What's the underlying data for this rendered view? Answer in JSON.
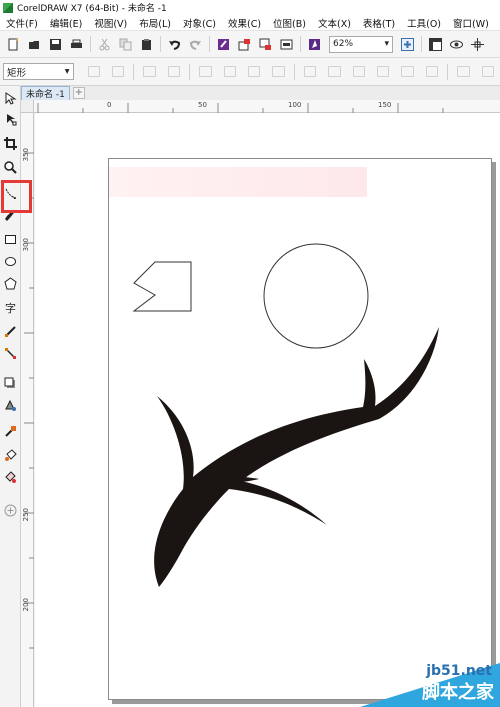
{
  "window": {
    "title": "CorelDRAW X7 (64-Bit) - 未命名 -1"
  },
  "menu": {
    "items": [
      "文件(F)",
      "编辑(E)",
      "视图(V)",
      "布局(L)",
      "对象(C)",
      "效果(C)",
      "位图(B)",
      "文本(X)",
      "表格(T)",
      "工具(O)",
      "窗口(W)"
    ]
  },
  "toolbar": {
    "zoom_value": "62%",
    "icons": [
      "new-icon",
      "open-icon",
      "save-icon",
      "print-icon",
      "cut-icon",
      "copy-icon",
      "paste-icon",
      "undo-icon",
      "redo-icon",
      "search-content-icon",
      "import-icon",
      "export-icon",
      "publish-pdf-icon",
      "app-launcher-icon",
      "zoom-page-icon",
      "show-rulers-icon",
      "view-icon",
      "snap-icon"
    ]
  },
  "property_bar": {
    "shape_mode": "矩形"
  },
  "document": {
    "tab_label": "未命名 -1",
    "add_tab": "+"
  },
  "rulers": {
    "h_labels": [
      "0",
      "50",
      "100",
      "150"
    ],
    "v_labels": [
      "350",
      "300",
      "250",
      "200"
    ]
  },
  "toolbox": {
    "text_tool_glyph": "字",
    "tools": [
      "pick-tool-icon",
      "shape-tool-icon",
      "crop-tool-icon",
      "zoom-tool-icon",
      "freehand-tool-icon",
      "artistic-media-icon",
      "rectangle-tool-icon",
      "ellipse-tool-icon",
      "polygon-tool-icon",
      "text-tool-icon",
      "parallel-dimension-icon",
      "connector-icon",
      "drop-shadow-icon",
      "transparency-icon",
      "eyedropper-icon",
      "interactive-fill-icon",
      "smart-fill-icon",
      "add-tool-icon"
    ],
    "highlighted_tool": "freehand-tool-icon"
  },
  "colors": {
    "highlight": "#e53935",
    "branch_fill": "#1a1512",
    "watermark_blue": "#2fa6de"
  },
  "watermark": {
    "site": "jb51.net",
    "text": "脚本之家"
  }
}
